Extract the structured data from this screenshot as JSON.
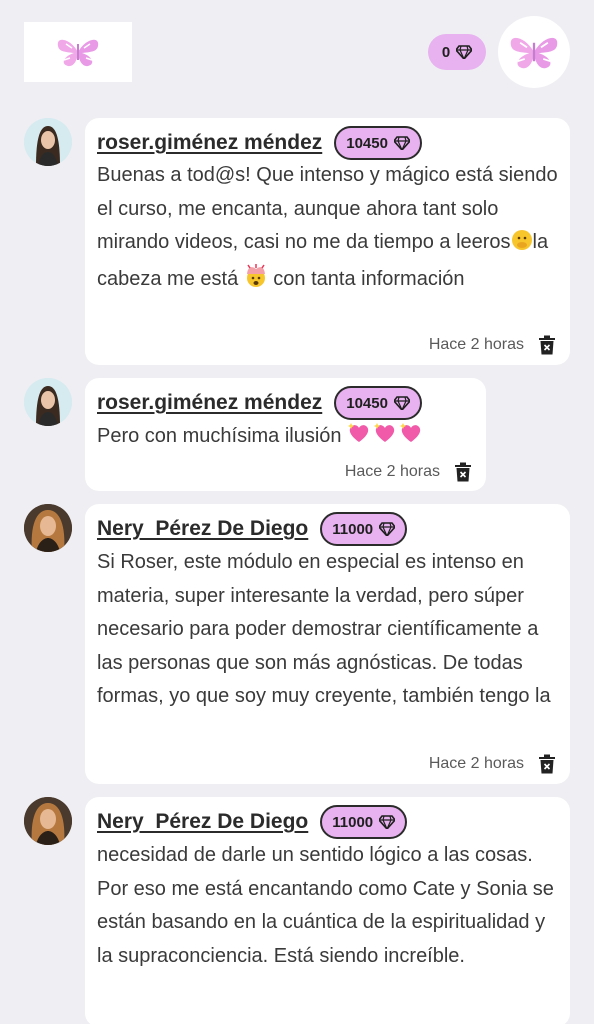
{
  "header": {
    "gem_count": "0",
    "logo_left_icon": "butterfly-logo-icon",
    "logo_right_icon": "butterfly-logo-icon",
    "gem_icon": "diamond-icon"
  },
  "colors": {
    "background": "#efeff3",
    "accent_pink": "#e7b2ef",
    "card": "#ffffff"
  },
  "comments": [
    {
      "author": "roser.giménez méndez",
      "points": "10450",
      "text_before_emoji_1": "Buenas a tod@s! Que intenso y mágico está siendo el curso, me encanta, aunque ahora tant solo mirando videos, casi no me da tiempo a leeros",
      "text_mid": "la cabeza me está ",
      "text_after": " con tanta información",
      "time": "Hace 2 horas"
    },
    {
      "author": "roser.giménez méndez",
      "points": "10450",
      "text": "Pero con muchísima ilusión ",
      "time": "Hace 2 horas"
    },
    {
      "author": "Nery  Pérez De Diego",
      "points": "11000",
      "text": "Si Roser, este módulo en especial es intenso en materia, super interesante la verdad, pero súper necesario para poder demostrar científicamente a las personas que son más agnósticas. De todas formas, yo que soy muy creyente, también tengo la",
      "time": "Hace 2 horas"
    },
    {
      "author": "Nery  Pérez De Diego",
      "points": "11000",
      "text": "necesidad de darle un sentido lógico a las cosas. Por eso me está encantando como Cate y Sonia se están basando en la cuántica de la espiritualidad y la supraconciencia. Está siendo increíble."
    }
  ]
}
